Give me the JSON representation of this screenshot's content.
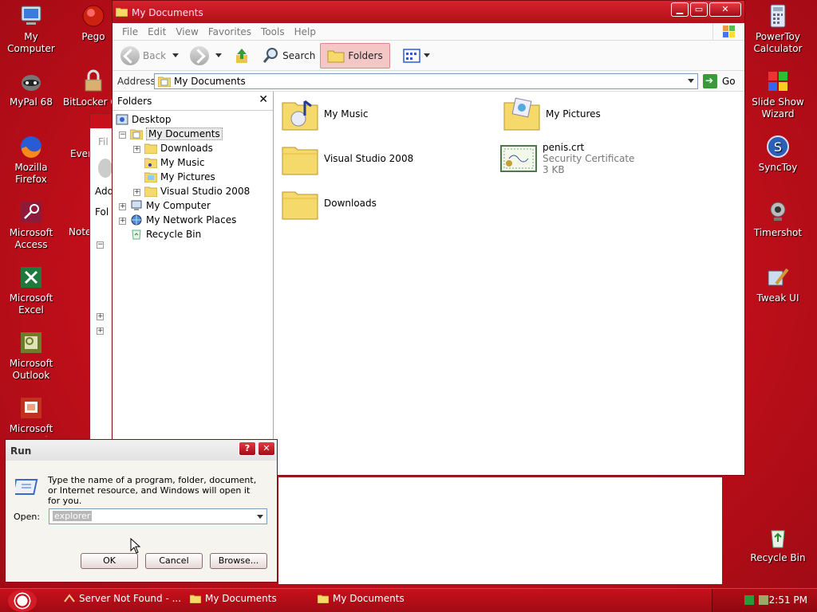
{
  "desktop": {
    "left_icons": [
      {
        "label": "My Computer",
        "icon": "computer-icon"
      },
      {
        "label": "Pego",
        "icon": "pego-icon"
      },
      {
        "label": "MyPal 68",
        "icon": "mypal-icon"
      },
      {
        "label": "BitLocker Go ...",
        "icon": "bitlocker-icon"
      },
      {
        "label": "Mozilla Firefox",
        "icon": "firefox-icon"
      },
      {
        "label": "Ever...",
        "icon": "evernote-icon"
      },
      {
        "label": "Microsoft Access",
        "icon": "access-icon"
      },
      {
        "label": "Note...",
        "icon": "notepad-icon"
      },
      {
        "label": "Microsoft Excel",
        "icon": "excel-icon"
      },
      {
        "label": "Microsoft Outlook",
        "icon": "outlook-icon"
      },
      {
        "label": "Microsoft PowerPoint",
        "icon": "powerpoint-icon"
      }
    ],
    "right_icons": [
      {
        "label": "PowerToy Calculator",
        "icon": "calculator-icon"
      },
      {
        "label": "Slide Show Wizard",
        "icon": "slideshow-icon"
      },
      {
        "label": "SyncToy",
        "icon": "synctoy-icon"
      },
      {
        "label": "Timershot",
        "icon": "webcam-icon"
      },
      {
        "label": "Tweak UI",
        "icon": "tweakui-icon"
      },
      {
        "label": "Recycle Bin",
        "icon": "recycle-bin-icon"
      }
    ]
  },
  "explorer": {
    "title": "My Documents",
    "menu": [
      "File",
      "Edit",
      "View",
      "Favorites",
      "Tools",
      "Help"
    ],
    "toolbar": {
      "back": "Back",
      "search": "Search",
      "folders": "Folders"
    },
    "address": {
      "label": "Address",
      "value": "My Documents",
      "go": "Go"
    },
    "folders_pane": {
      "title": "Folders",
      "tree": [
        {
          "label": "Desktop"
        },
        {
          "label": "My Documents"
        },
        {
          "label": "Downloads"
        },
        {
          "label": "My Music"
        },
        {
          "label": "My Pictures"
        },
        {
          "label": "Visual Studio 2008"
        },
        {
          "label": "My Computer"
        },
        {
          "label": "My Network Places"
        },
        {
          "label": "Recycle Bin"
        }
      ]
    },
    "items": [
      {
        "name": "My Music"
      },
      {
        "name": "My Pictures"
      },
      {
        "name": "Visual Studio 2008"
      },
      {
        "name": "penis.crt",
        "type": "Security Certificate",
        "size": "3 KB"
      },
      {
        "name": "Downloads"
      }
    ]
  },
  "behind_window": {
    "fragments": [
      "Fil",
      "Add",
      "Fol"
    ]
  },
  "run_dialog": {
    "title": "Run",
    "help": "?",
    "description": "Type the name of a program, folder, document, or Internet resource, and Windows will open it for you.",
    "open_label": "Open:",
    "open_value": "explorer",
    "ok": "OK",
    "cancel": "Cancel",
    "browse": "Browse..."
  },
  "taskbar": {
    "tasks": [
      "Server Not Found - ...",
      "My Documents",
      "My Documents"
    ],
    "clock": "2:51 PM"
  }
}
